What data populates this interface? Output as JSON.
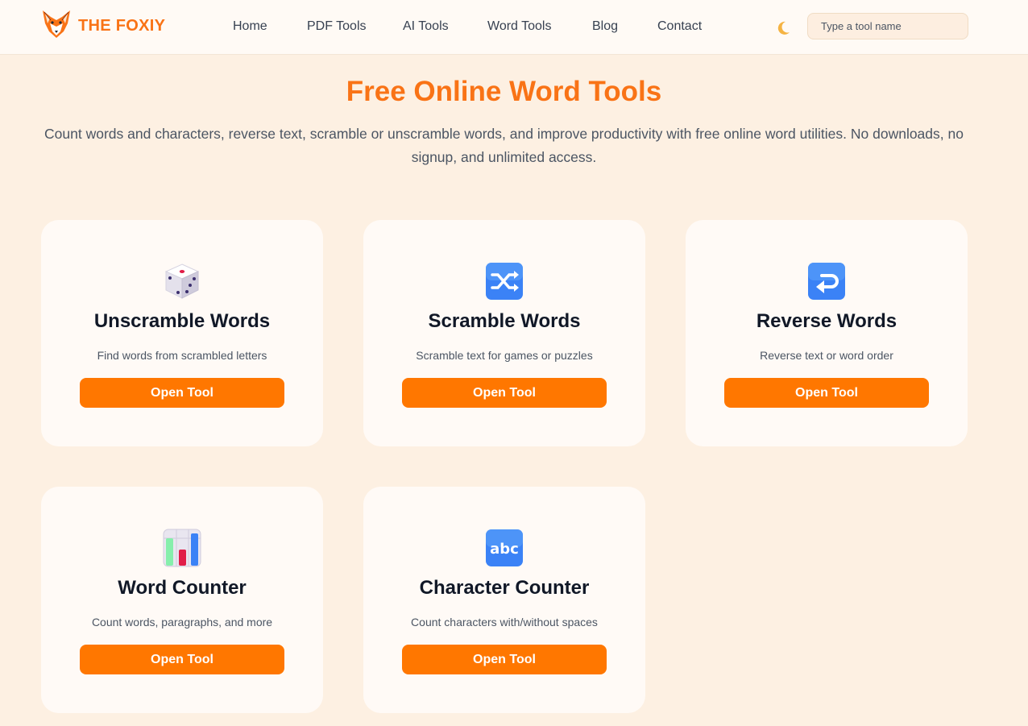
{
  "brand": {
    "name": "THE FOXIY",
    "logo_icon": "fox-logo",
    "accent": "#f97316"
  },
  "nav": {
    "items": [
      {
        "label": "Home"
      },
      {
        "label": "PDF Tools"
      },
      {
        "label": "AI Tools"
      },
      {
        "label": "Word Tools"
      },
      {
        "label": "Blog"
      },
      {
        "label": "Contact"
      }
    ]
  },
  "header": {
    "theme_icon": "moon-icon",
    "search_placeholder": "Type a tool name"
  },
  "hero": {
    "title": "Free Online Word Tools",
    "description": "Count words and characters, reverse text, scramble or unscramble words, and improve productivity with free online word utilities. No downloads, no signup, and unlimited access."
  },
  "tools": [
    {
      "title": "Unscramble Words",
      "desc": "Find words from scrambled letters",
      "button": "Open Tool",
      "icon": "dice-icon"
    },
    {
      "title": "Scramble Words",
      "desc": "Scramble text for games or puzzles",
      "button": "Open Tool",
      "icon": "shuffle-icon"
    },
    {
      "title": "Reverse Words",
      "desc": "Reverse text or word order",
      "button": "Open Tool",
      "icon": "return-arrow-icon"
    },
    {
      "title": "Word Counter",
      "desc": "Count words, paragraphs, and more",
      "button": "Open Tool",
      "icon": "bar-chart-icon"
    },
    {
      "title": "Character Counter",
      "desc": "Count characters with/without spaces",
      "button": "Open Tool",
      "icon": "abc-icon"
    }
  ],
  "colors": {
    "page_bg": "#fdf0e2",
    "button": "#ff7700",
    "card_bg": "#fffaf6"
  }
}
